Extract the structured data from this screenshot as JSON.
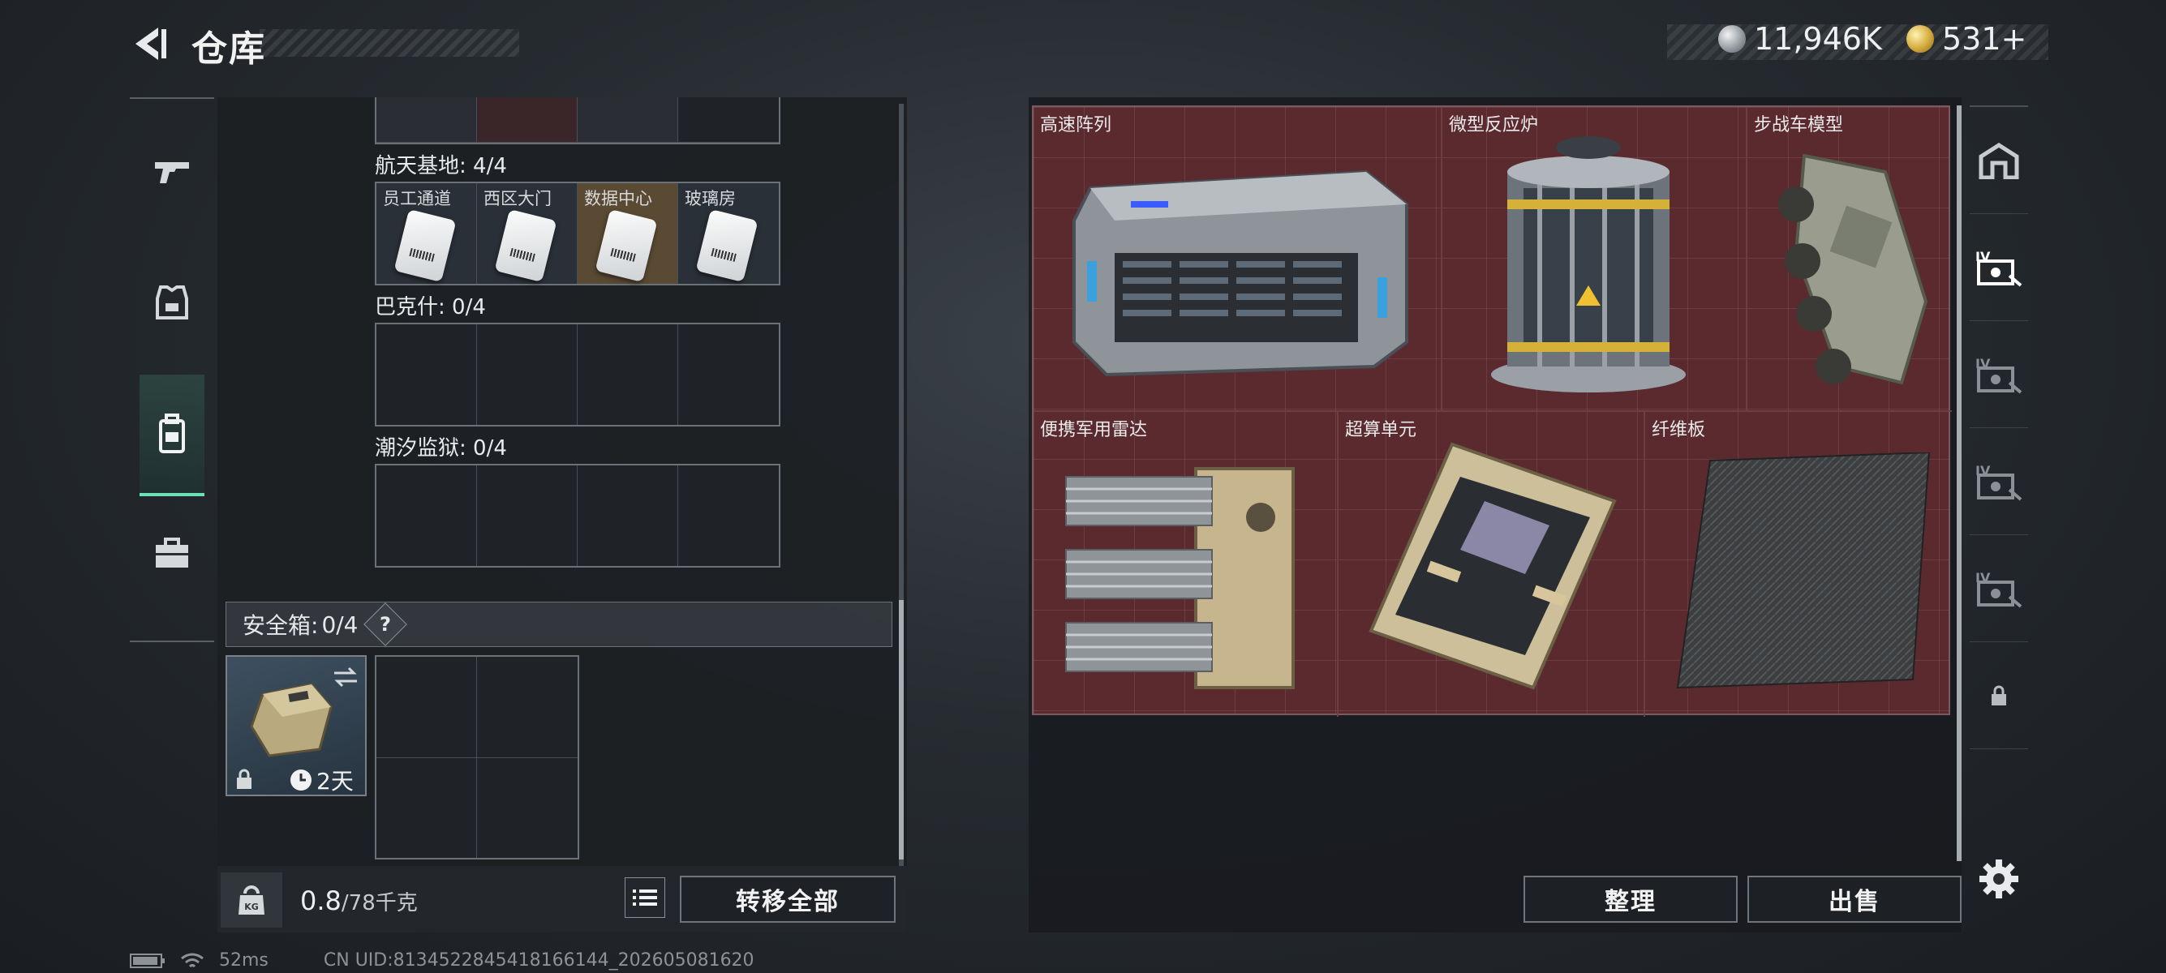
{
  "header": {
    "title": "仓库"
  },
  "currency": {
    "coins": "11,946K",
    "premium": "531+"
  },
  "left_nav": {
    "items": [
      "weapon",
      "armor",
      "backpack",
      "toolbox"
    ]
  },
  "storage_sections": [
    {
      "title": "航天基地: 4/4",
      "slots": [
        "员工通道",
        "西区大门",
        "数据中心",
        "玻璃房"
      ]
    },
    {
      "title": "巴克什: 0/4",
      "slots": [
        "",
        "",
        "",
        ""
      ]
    },
    {
      "title": "潮汐监狱: 0/4",
      "slots": [
        "",
        "",
        "",
        ""
      ]
    }
  ],
  "safe_box": {
    "label": "安全箱:",
    "count": "0/4",
    "help": "?",
    "timer": "2天"
  },
  "weight": {
    "current": "0.8",
    "max": "/78千克"
  },
  "buttons": {
    "transfer_all": "转移全部",
    "organize": "整理",
    "sell": "出售"
  },
  "container_items": [
    {
      "name": "高速阵列",
      "icon": "server-array"
    },
    {
      "name": "微型反应炉",
      "icon": "reactor"
    },
    {
      "name": "步战车模型",
      "icon": "ifv-model"
    },
    {
      "name": "便携军用雷达",
      "icon": "radar"
    },
    {
      "name": "超算单元",
      "icon": "supercomputer-board"
    },
    {
      "name": "纤维板",
      "icon": "fiber-board"
    }
  ],
  "right_nav": {
    "tier_label": "IV"
  },
  "status_bar": {
    "ping": "52ms",
    "uid": "CN UID:8134522845418166144_202605081620"
  },
  "colors": {
    "accent": "#6ee0b8",
    "grid_bg": "#5a2a2f",
    "gold_slot": "#5a4a33"
  }
}
